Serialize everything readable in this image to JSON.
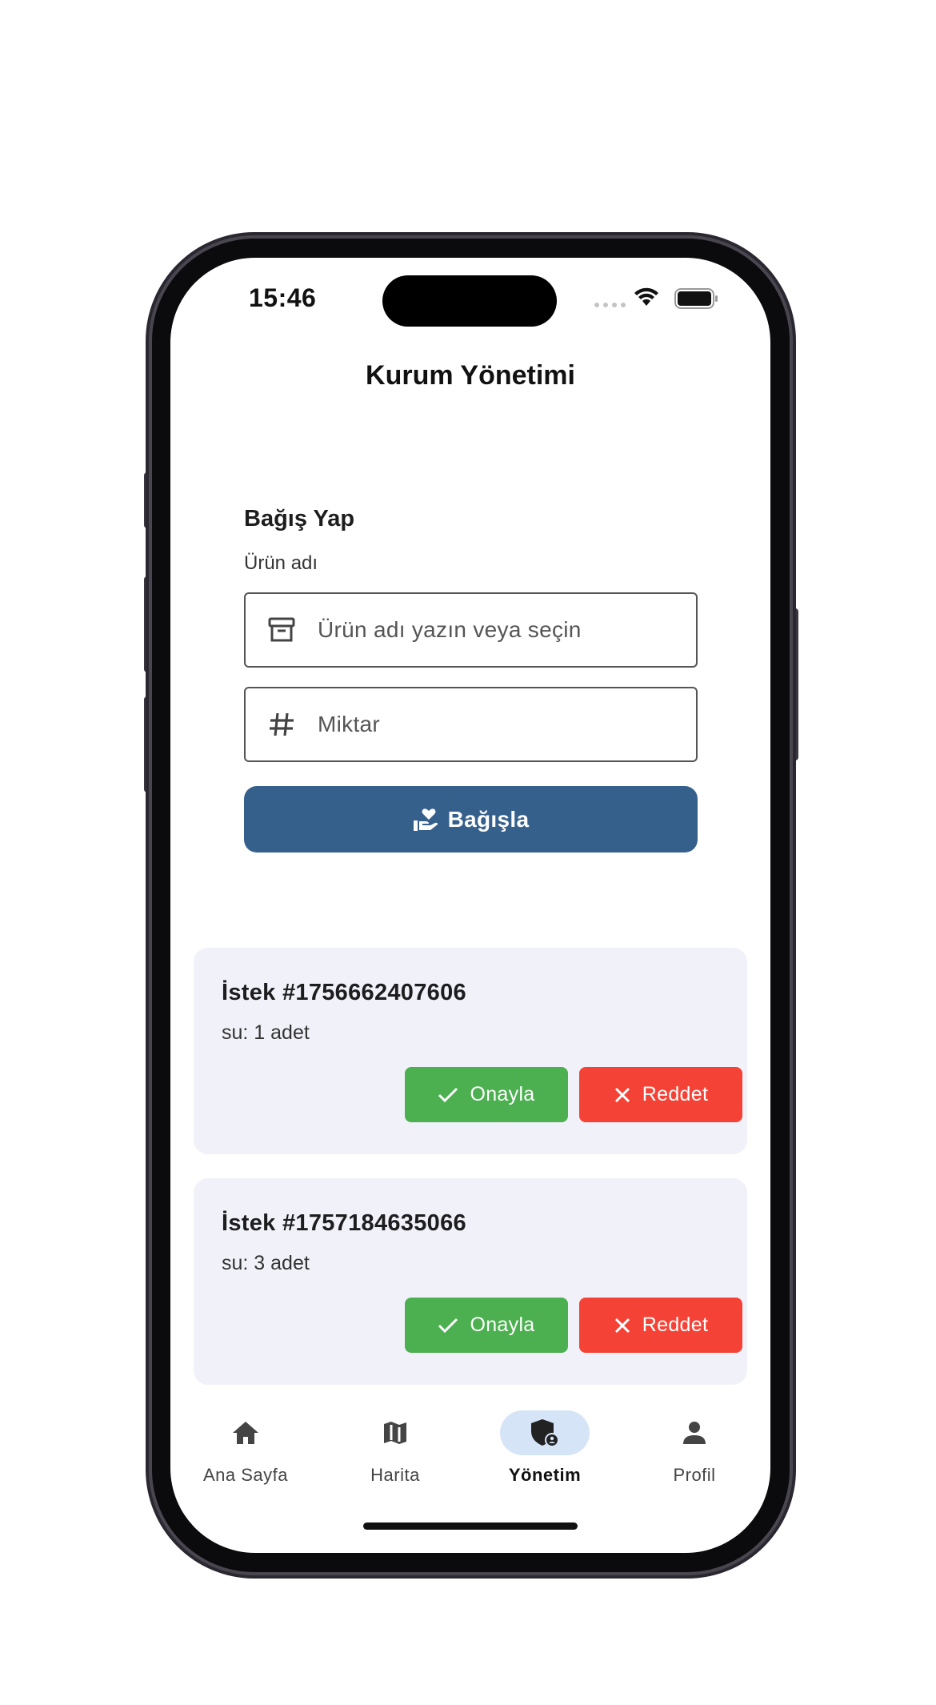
{
  "status_bar": {
    "time": "15:46"
  },
  "page": {
    "title": "Kurum Yönetimi"
  },
  "donate_form": {
    "section_title": "Bağış Yap",
    "product_label": "Ürün adı",
    "product_placeholder": "Ürün adı yazın veya seçin",
    "amount_placeholder": "Miktar",
    "submit_label": "Bağışla",
    "colors": {
      "button": "#36608c"
    }
  },
  "requests": [
    {
      "title": "İstek #1756662407606",
      "detail": "su: 1 adet",
      "approve_label": "Onayla",
      "reject_label": "Reddet"
    },
    {
      "title": "İstek #1757184635066",
      "detail": "su: 3 adet",
      "approve_label": "Onayla",
      "reject_label": "Reddet"
    }
  ],
  "action_colors": {
    "approve": "#4caf50",
    "reject": "#f44336"
  },
  "bottom_nav": {
    "items": [
      {
        "label": "Ana Sayfa",
        "icon": "home-icon",
        "active": false
      },
      {
        "label": "Harita",
        "icon": "map-icon",
        "active": false
      },
      {
        "label": "Yönetim",
        "icon": "admin-shield-icon",
        "active": true
      },
      {
        "label": "Profil",
        "icon": "person-icon",
        "active": false
      }
    ]
  }
}
